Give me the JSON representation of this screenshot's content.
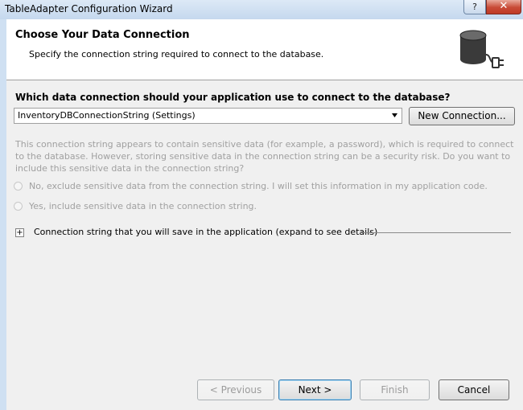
{
  "window": {
    "title": "TableAdapter Configuration Wizard",
    "help_label": "?",
    "close_label": "✕"
  },
  "header": {
    "title": "Choose Your Data Connection",
    "subtitle": "Specify the connection string required to connect to the database.",
    "icon": "database-plug-icon"
  },
  "connection": {
    "question": "Which data connection should your application use to connect to the database?",
    "selected_value": "InventoryDBConnectionString (Settings)",
    "new_connection_label": "New Connection..."
  },
  "sensitive": {
    "warning": "This connection string appears to contain sensitive data (for example, a password), which is required to connect to the database. However, storing sensitive data in the connection string can be a security risk. Do you want to include this sensitive data in the connection string?",
    "option_exclude": "No, exclude sensitive data from the connection string. I will set this information in my application code.",
    "option_include": "Yes, include sensitive data in the connection string."
  },
  "details": {
    "expander_label": "Connection string that you will save in the application (expand to see details)",
    "expander_glyph": "+"
  },
  "footer": {
    "previous_label": "< Previous",
    "next_label": "Next >",
    "finish_label": "Finish",
    "cancel_label": "Cancel"
  }
}
